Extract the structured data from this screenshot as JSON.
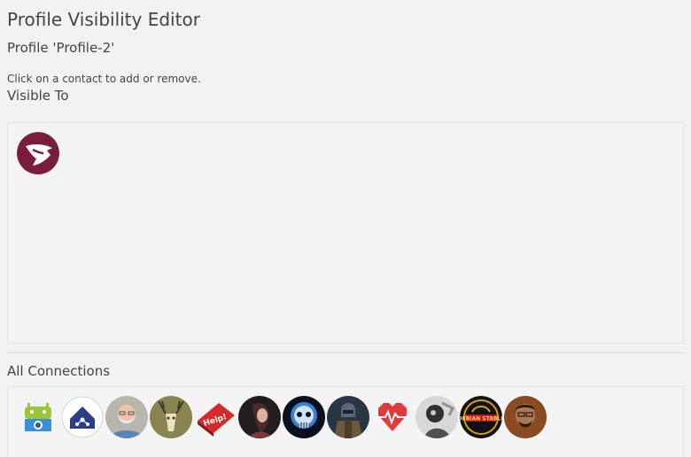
{
  "page": {
    "title": "Profile Visibility Editor",
    "profile_label": "Profile 'Profile-2'",
    "help_text": "Click on a contact to add or remove.",
    "visible_heading": "Visible To",
    "all_heading": "All Connections"
  },
  "visible_contacts": [
    {
      "icon": "dragon-logo-avatar"
    }
  ],
  "all_connections": [
    {
      "icon": "android-camera-app-avatar"
    },
    {
      "icon": "house-network-avatar"
    },
    {
      "icon": "bearded-man-avatar"
    },
    {
      "icon": "deer-skull-avatar"
    },
    {
      "icon": "help-key-avatar"
    },
    {
      "icon": "woman-portrait-avatar"
    },
    {
      "icon": "blue-skull-avatar"
    },
    {
      "icon": "armored-figure-avatar"
    },
    {
      "icon": "pixel-heart-avatar"
    },
    {
      "icon": "monochrome-figure-avatar"
    },
    {
      "icon": "debian-stable-logo-avatar"
    },
    {
      "icon": "man-glasses-avatar"
    }
  ]
}
